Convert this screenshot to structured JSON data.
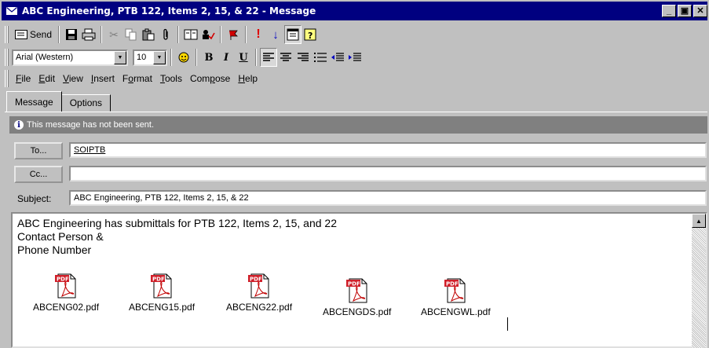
{
  "window": {
    "title": "ABC Engineering, PTB 122, Items 2, 15, & 22 - Message",
    "controls": {
      "minimize": "_",
      "maximize": "▣",
      "close": "✕"
    }
  },
  "toolbar": {
    "send_label": "Send",
    "icons": [
      "save-icon",
      "print-icon",
      "cut-icon",
      "copy-icon",
      "paste-icon",
      "attach-icon",
      "address-book-icon",
      "check-names-icon",
      "flag-icon",
      "importance-high-icon",
      "importance-low-icon",
      "options-icon",
      "help-icon"
    ]
  },
  "format_bar": {
    "font": "Arial (Western)",
    "size": "10",
    "bold": "B",
    "italic": "I",
    "underline": "U"
  },
  "menu": {
    "items": [
      {
        "key": "F",
        "rest": "ile"
      },
      {
        "key": "E",
        "rest": "dit"
      },
      {
        "key": "V",
        "rest": "iew"
      },
      {
        "key": "I",
        "rest": "nsert"
      },
      {
        "key": "o",
        "pre": "F",
        "rest": "rmat"
      },
      {
        "key": "T",
        "rest": "ools"
      },
      {
        "key": "p",
        "pre": "Com",
        "rest": "ose"
      },
      {
        "key": "H",
        "rest": "elp"
      }
    ]
  },
  "tabs": {
    "message": "Message",
    "options": "Options"
  },
  "info": {
    "text": "This message has not been sent."
  },
  "addressing": {
    "to_label": "To...",
    "to_value": "SOIPTB",
    "cc_label": "Cc...",
    "cc_value": "",
    "subject_label": "Subject:",
    "subject_value": "ABC Engineering, PTB 122, Items 2, 15, & 22"
  },
  "body": {
    "lines": [
      "ABC Engineering has submittals for PTB 122, Items 2, 15, and 22",
      "Contact Person &",
      "Phone Number"
    ],
    "attachments": [
      "ABCENG02.pdf",
      "ABCENG15.pdf",
      "ABCENG22.pdf",
      "ABCENGDS.pdf",
      "ABCENGWL.pdf"
    ]
  },
  "colors": {
    "titlebar": "#000080",
    "chrome": "#c0c0c0",
    "infobar": "#808080",
    "pdf_red": "#d0202a"
  }
}
